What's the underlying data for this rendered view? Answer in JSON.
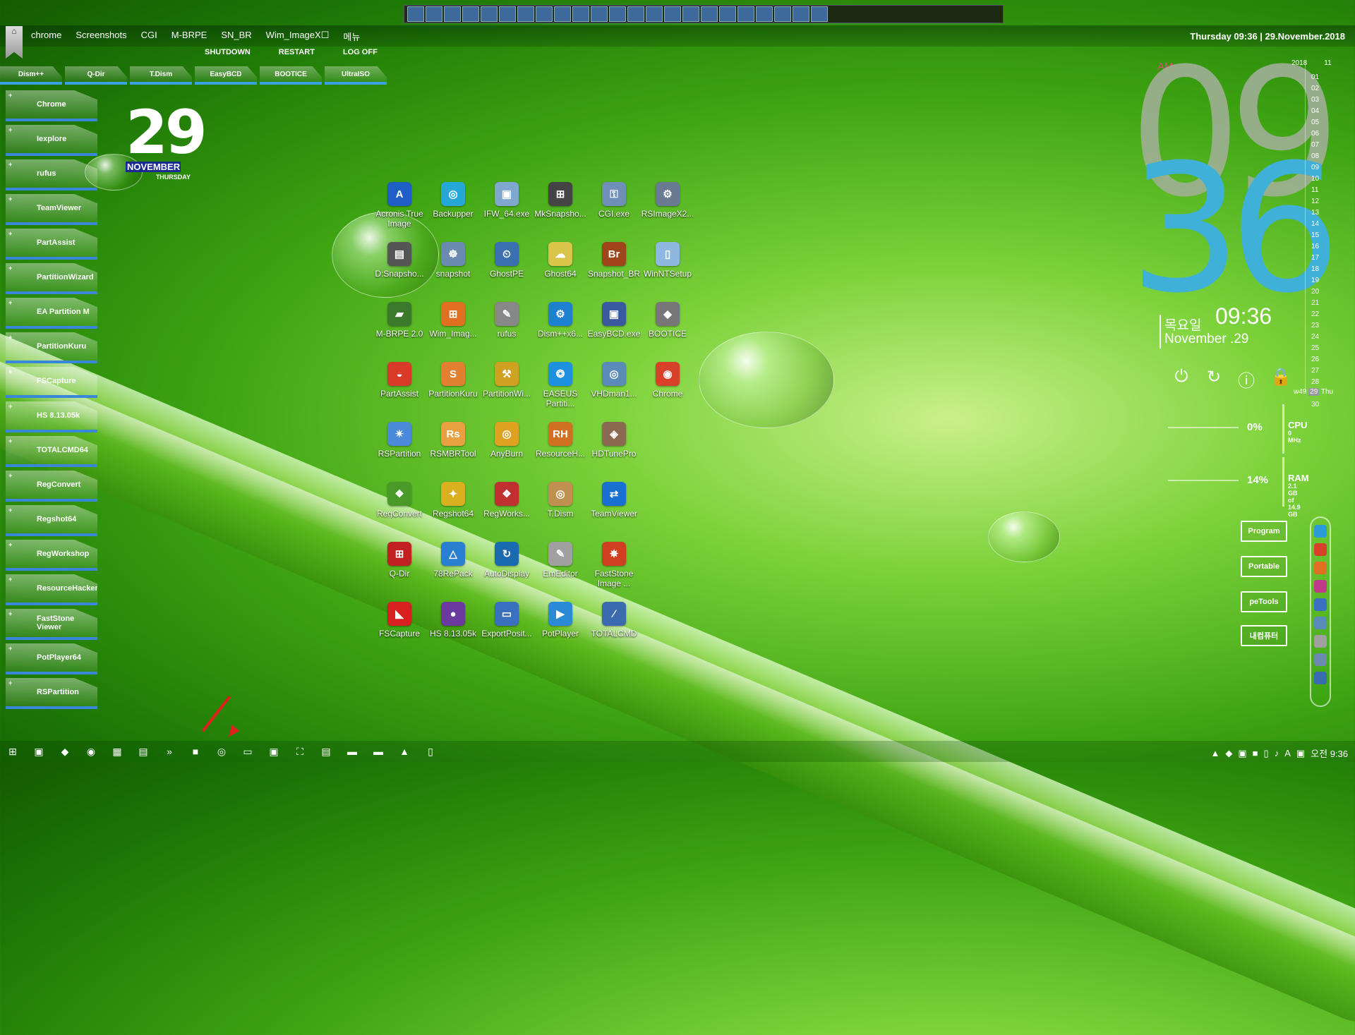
{
  "quickbar": {
    "icons": [
      "app",
      "triangle",
      "window",
      "A",
      "windows",
      "Br",
      "globe",
      "disk",
      "image",
      "pen",
      "book",
      "page",
      "cd",
      "search",
      "gear",
      "box",
      "hat",
      "tool",
      "key",
      "swirl",
      "R",
      "A",
      "tree"
    ]
  },
  "menubar": {
    "items": [
      "chrome",
      "Screenshots",
      "CGI",
      "M-BRPE",
      "SN_BR",
      "Wim_ImageX☐",
      "메뉴"
    ]
  },
  "top_datetime": "Thursday 09:36 | 29.November.2018",
  "power": [
    "SHUTDOWN",
    "RESTART",
    "LOG OFF"
  ],
  "tools": [
    "Dism++",
    "Q-Dir",
    "T.Dism",
    "EasyBCD",
    "BOOTICE",
    "UltraISO"
  ],
  "sidebar": {
    "items": [
      "Chrome",
      "Iexplore",
      "rufus",
      "TeamViewer",
      "PartAssist",
      "PartitionWizard",
      "EA Partition M",
      "PartitionKuru",
      "FSCapture",
      "HS 8.13.05k",
      "TOTALCMD64",
      "RegConvert",
      "Regshot64",
      "RegWorkshop",
      "ResourceHacker",
      "FastStone Viewer",
      "PotPlayer64",
      "RSPartition"
    ]
  },
  "bigdate": {
    "day": "29",
    "month": "NOVEMBER",
    "weekday": "THURSDAY"
  },
  "desktop": {
    "icons": [
      {
        "label": "Acronis True Image",
        "glyph": "A",
        "color": "#1d5fc4"
      },
      {
        "label": "Backupper",
        "glyph": "◎",
        "color": "#25a7d8"
      },
      {
        "label": "IFW_64.exe",
        "glyph": "▣",
        "color": "#7fa7d0"
      },
      {
        "label": "MkSnapsho...",
        "glyph": "⊞",
        "color": "#444"
      },
      {
        "label": "CGI.exe",
        "glyph": "⚿",
        "color": "#6f8fb8"
      },
      {
        "label": "RSImageX2...",
        "glyph": "⚙",
        "color": "#6a7a90"
      },
      {
        "label": "D:Snapsho...",
        "glyph": "▤",
        "color": "#555"
      },
      {
        "label": "snapshot",
        "glyph": "☸",
        "color": "#6a8ab0"
      },
      {
        "label": "GhostPE",
        "glyph": "⏲",
        "color": "#3a6fb0"
      },
      {
        "label": "Ghost64",
        "glyph": "☁",
        "color": "#d8c54a"
      },
      {
        "label": "Snapshot_BR",
        "glyph": "Br",
        "color": "#a0441b"
      },
      {
        "label": "WinNTSetup",
        "glyph": "▯",
        "color": "#8fb8e0"
      },
      {
        "label": "M-BRPE 2.0",
        "glyph": "▰",
        "color": "#3a7a2a"
      },
      {
        "label": "Wim_Imag...",
        "glyph": "⊞",
        "color": "#e07020"
      },
      {
        "label": "rufus",
        "glyph": "✎",
        "color": "#888"
      },
      {
        "label": "Dism++x6...",
        "glyph": "⚙",
        "color": "#1e80d0"
      },
      {
        "label": "EasyBCD.exe",
        "glyph": "▣",
        "color": "#3a5aa0"
      },
      {
        "label": "BOOTICE",
        "glyph": "◆",
        "color": "#777"
      },
      {
        "label": "PartAssist",
        "glyph": "◒",
        "color": "#d83a2a"
      },
      {
        "label": "PartitionKuru",
        "glyph": "S",
        "color": "#e08030"
      },
      {
        "label": "PartitionWi...",
        "glyph": "⚒",
        "color": "#d0a020"
      },
      {
        "label": "EASEUS Partiti...",
        "glyph": "❂",
        "color": "#1e90e0"
      },
      {
        "label": "VHDman1...",
        "glyph": "◎",
        "color": "#5a8ab8"
      },
      {
        "label": "Chrome",
        "glyph": "◉",
        "color": "#d8402a"
      },
      {
        "label": "RSPartition",
        "glyph": "✴",
        "color": "#4a8ad8"
      },
      {
        "label": "RSMBRTool",
        "glyph": "Rs",
        "color": "#e8a040"
      },
      {
        "label": "AnyBurn",
        "glyph": "◎",
        "color": "#e0a020"
      },
      {
        "label": "ResourceH...",
        "glyph": "RH",
        "color": "#d07020"
      },
      {
        "label": "HDTunePro",
        "glyph": "◈",
        "color": "#8a6a50"
      },
      {
        "label": "",
        "glyph": "",
        "color": "transparent"
      },
      {
        "label": "RegConvert",
        "glyph": "❖",
        "color": "#4a9a2a"
      },
      {
        "label": "Regshot64",
        "glyph": "✦",
        "color": "#d8b020"
      },
      {
        "label": "RegWorks...",
        "glyph": "❖",
        "color": "#c03030"
      },
      {
        "label": "T.Dism",
        "glyph": "◎",
        "color": "#c09050"
      },
      {
        "label": "TeamViewer",
        "glyph": "⇄",
        "color": "#1a70d0"
      },
      {
        "label": "",
        "glyph": "",
        "color": "transparent"
      },
      {
        "label": "Q-Dir",
        "glyph": "⊞",
        "color": "#c02020"
      },
      {
        "label": "78RePack",
        "glyph": "△",
        "color": "#2a80d0"
      },
      {
        "label": "AutoDisplay",
        "glyph": "↻",
        "color": "#1a6ab0"
      },
      {
        "label": "EmEditor",
        "glyph": "✎",
        "color": "#a0a0a0"
      },
      {
        "label": "FastStone Image ...",
        "glyph": "✵",
        "color": "#d04020"
      },
      {
        "label": "",
        "glyph": "",
        "color": "transparent"
      },
      {
        "label": "FSCapture",
        "glyph": "◣",
        "color": "#d82020"
      },
      {
        "label": "HS 8.13.05k",
        "glyph": "●",
        "color": "#6a3aa0"
      },
      {
        "label": "ExportPosit...",
        "glyph": "▭",
        "color": "#3a70c0"
      },
      {
        "label": "PotPlayer",
        "glyph": "▶",
        "color": "#2a8ad8"
      },
      {
        "label": "TOTALCMD",
        "glyph": "∕",
        "color": "#3a6ab0"
      }
    ]
  },
  "clock": {
    "ampm": "AM",
    "hour": "09",
    "minute": "36",
    "kday": "목요일",
    "ktime": "09:36",
    "kdate": "November .29"
  },
  "sys_icons": [
    "⏻",
    "↻",
    "ⓘ",
    "🔒"
  ],
  "cpu": {
    "pct": "0%",
    "label": "CPU",
    "sub": "0 MHz"
  },
  "ram": {
    "pct": "14%",
    "label": "RAM",
    "sub1": "2.1 GB",
    "sub2": "of 14.9 GB"
  },
  "calendar": {
    "year": "2018",
    "month": "11",
    "days": [
      "01",
      "02",
      "03",
      "04",
      "05",
      "06",
      "07",
      "08",
      "09",
      "10",
      "11",
      "12",
      "13",
      "14",
      "15",
      "16",
      "17",
      "18",
      "19",
      "20",
      "21",
      "22",
      "23",
      "24",
      "25",
      "26",
      "27",
      "28",
      "29",
      "30"
    ],
    "week": "w49",
    "today": "29",
    "weekday": "Thu"
  },
  "folders": [
    "Program",
    "Portable",
    "peTools",
    "내컴퓨터"
  ],
  "dock_colors": [
    "#2a9ad8",
    "#d8402a",
    "#e07020",
    "#c03a8a",
    "#3a70c0",
    "#5a8ab8",
    "#a0a0a0",
    "#6a8ab0",
    "#3a6ab0"
  ],
  "taskbar": {
    "icons": [
      "⊞",
      "▣",
      "◆",
      "◉",
      "▦",
      "▤",
      "»",
      "■",
      "◎",
      "▭",
      "▣",
      "⛶",
      "▤",
      "▬",
      "▬",
      "▲",
      "▯"
    ]
  },
  "tray": {
    "icons": [
      "▲",
      "◆",
      "▣",
      "■",
      "▯",
      "♪",
      "A",
      "▣"
    ],
    "time": "오전 9:36"
  }
}
